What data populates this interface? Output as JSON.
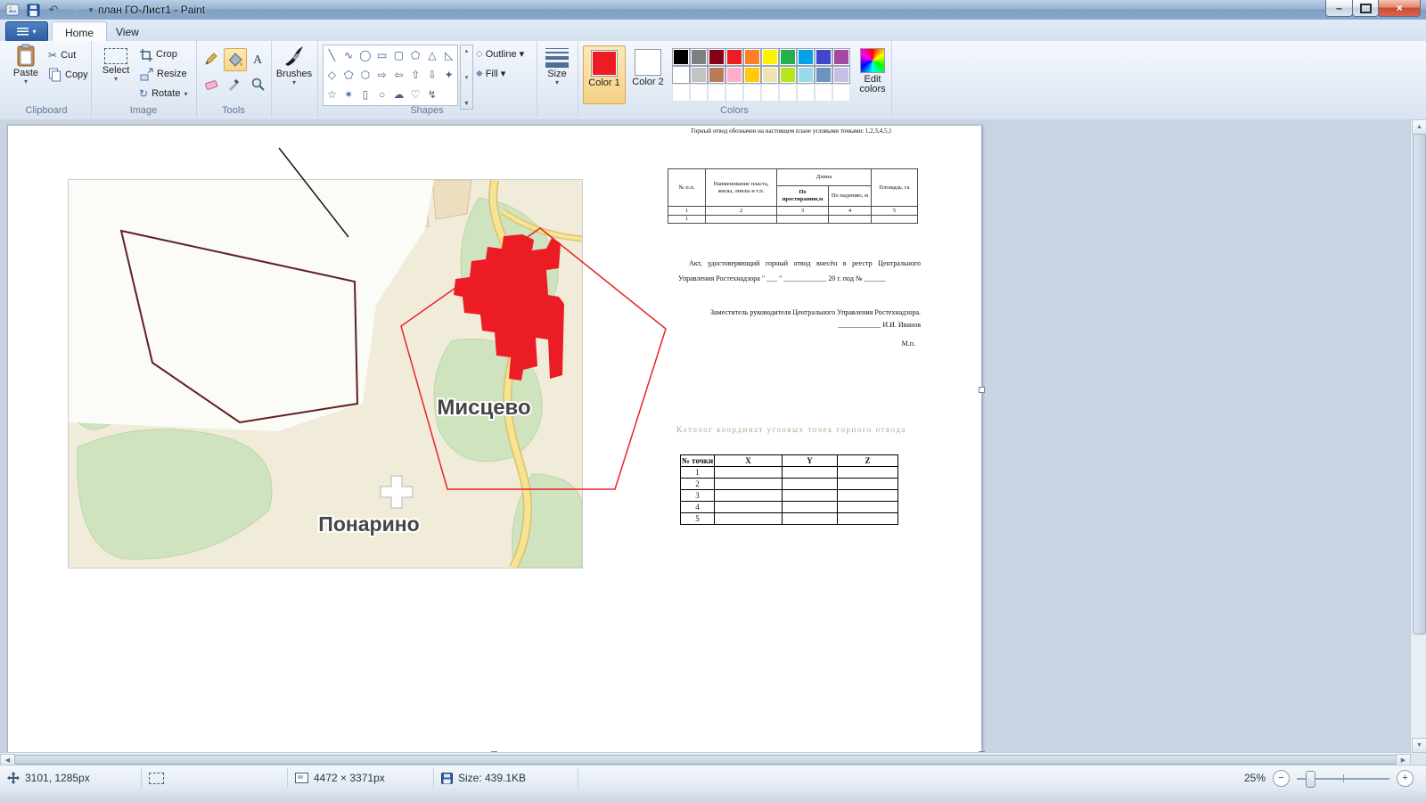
{
  "window": {
    "title": "план ГО-Лист1 - Paint"
  },
  "icons": {
    "dropdown": "▾",
    "cut": "✂",
    "rotate": "↻",
    "undo": "↶",
    "redo": "↷",
    "close": "×",
    "minimize": "–",
    "scroll_up": "▲",
    "scroll_down": "▼",
    "scroll_left": "◀",
    "scroll_right": "▶",
    "small_up": "▴",
    "small_down": "▾",
    "more": "▼",
    "outline_shape": "◇",
    "fill_shape": "◆",
    "zoom_out": "−",
    "zoom_in": "+"
  },
  "ribbon": {
    "tabs": [
      {
        "label": "Home"
      },
      {
        "label": "View"
      }
    ],
    "clipboard": {
      "label": "Clipboard",
      "paste": "Paste",
      "cut": "Cut",
      "copy": "Copy"
    },
    "image": {
      "label": "Image",
      "select": "Select",
      "crop": "Crop",
      "resize": "Resize",
      "rotate": "Rotate"
    },
    "tools": {
      "label": "Tools"
    },
    "brushes": {
      "label": "Brushes"
    },
    "shapes": {
      "label": "Shapes",
      "outline": "Outline",
      "fill": "Fill",
      "items": [
        {
          "name": "line",
          "glyph": "╲"
        },
        {
          "name": "curve",
          "glyph": "∿"
        },
        {
          "name": "oval",
          "glyph": "◯"
        },
        {
          "name": "rectangle",
          "glyph": "▭"
        },
        {
          "name": "rounded-rectangle",
          "glyph": "▢"
        },
        {
          "name": "polygon",
          "glyph": "⬠"
        },
        {
          "name": "triangle",
          "glyph": "△"
        },
        {
          "name": "right-triangle",
          "glyph": "◺"
        },
        {
          "name": "diamond",
          "glyph": "◇"
        },
        {
          "name": "pentagon",
          "glyph": "⬠"
        },
        {
          "name": "hexagon",
          "glyph": "⬡"
        },
        {
          "name": "right-arrow",
          "glyph": "⇨"
        },
        {
          "name": "left-arrow",
          "glyph": "⇦"
        },
        {
          "name": "up-arrow",
          "glyph": "⇧"
        },
        {
          "name": "down-arrow",
          "glyph": "⇩"
        },
        {
          "name": "four-point-star",
          "glyph": "✦"
        },
        {
          "name": "five-point-star",
          "glyph": "☆"
        },
        {
          "name": "six-point-star",
          "glyph": "✶"
        },
        {
          "name": "rounded-callout",
          "glyph": "▯"
        },
        {
          "name": "oval-callout",
          "glyph": "○"
        },
        {
          "name": "cloud-callout",
          "glyph": "☁"
        },
        {
          "name": "heart",
          "glyph": "♡"
        },
        {
          "name": "lightning",
          "glyph": "↯"
        },
        {
          "name": "empty",
          "glyph": ""
        }
      ]
    },
    "size": {
      "label": "Size"
    },
    "colors": {
      "label": "Colors",
      "color1_label": "Color 1",
      "color2_label": "Color 2",
      "edit_label": "Edit colors",
      "color1": "#ed1c24",
      "color2": "#ffffff",
      "palette": [
        [
          "#000000",
          "#7f7f7f",
          "#880015",
          "#ed1c24",
          "#ff7f27",
          "#fff200",
          "#22b14c",
          "#00a2e8",
          "#3f48cc",
          "#a349a4"
        ],
        [
          "#ffffff",
          "#c3c3c3",
          "#b97a57",
          "#ffaec9",
          "#ffc90e",
          "#efe4b0",
          "#b5e61d",
          "#99d9ea",
          "#7092be",
          "#c8bfe7"
        ],
        [
          "",
          "",
          "",
          "",
          "",
          "",
          "",
          "",
          "",
          ""
        ]
      ]
    }
  },
  "document": {
    "top_note": "Горный отвод обозначен на настоящем плане угловыми точками: 1,2,3,4,5,1",
    "map": {
      "labels": [
        "Мисцево",
        "Понарино"
      ]
    },
    "table1": {
      "header_num": "№ п.п.",
      "header_name": "Наименование пласта, жилы, линзы и т.п.",
      "header_length": "Длина",
      "header_strike": "По простиранию,м",
      "header_dip": "По падению, м",
      "header_area": "Площадь, га",
      "column_numbers": [
        "1",
        "2",
        "3",
        "4",
        "5"
      ],
      "first_row": [
        "1",
        "",
        "",
        "",
        ""
      ]
    },
    "act_line1": "Акт, удостоверяющий горный отвод внесён в реестр Центрального Управления",
    "act_line2": "Ростехнадзора \" ___ \" ____________ 20    г. под №  ______",
    "deputy_line": "Заместитель руководителя Центрального Управления  Ростехнадзора.",
    "signature_line": "____________  И.И. Иванов",
    "stamp": "М.п.",
    "catalog_title": "Котолог координат угловых точек горного отвода",
    "table2": {
      "headers": [
        "№ точки",
        "X",
        "Y",
        "Z"
      ],
      "rows": [
        "1",
        "2",
        "3",
        "4",
        "5"
      ]
    }
  },
  "statusbar": {
    "position": "3101, 1285px",
    "dimensions": "4472 × 3371px",
    "file_size": "Size: 439.1KB",
    "zoom": "25%"
  }
}
